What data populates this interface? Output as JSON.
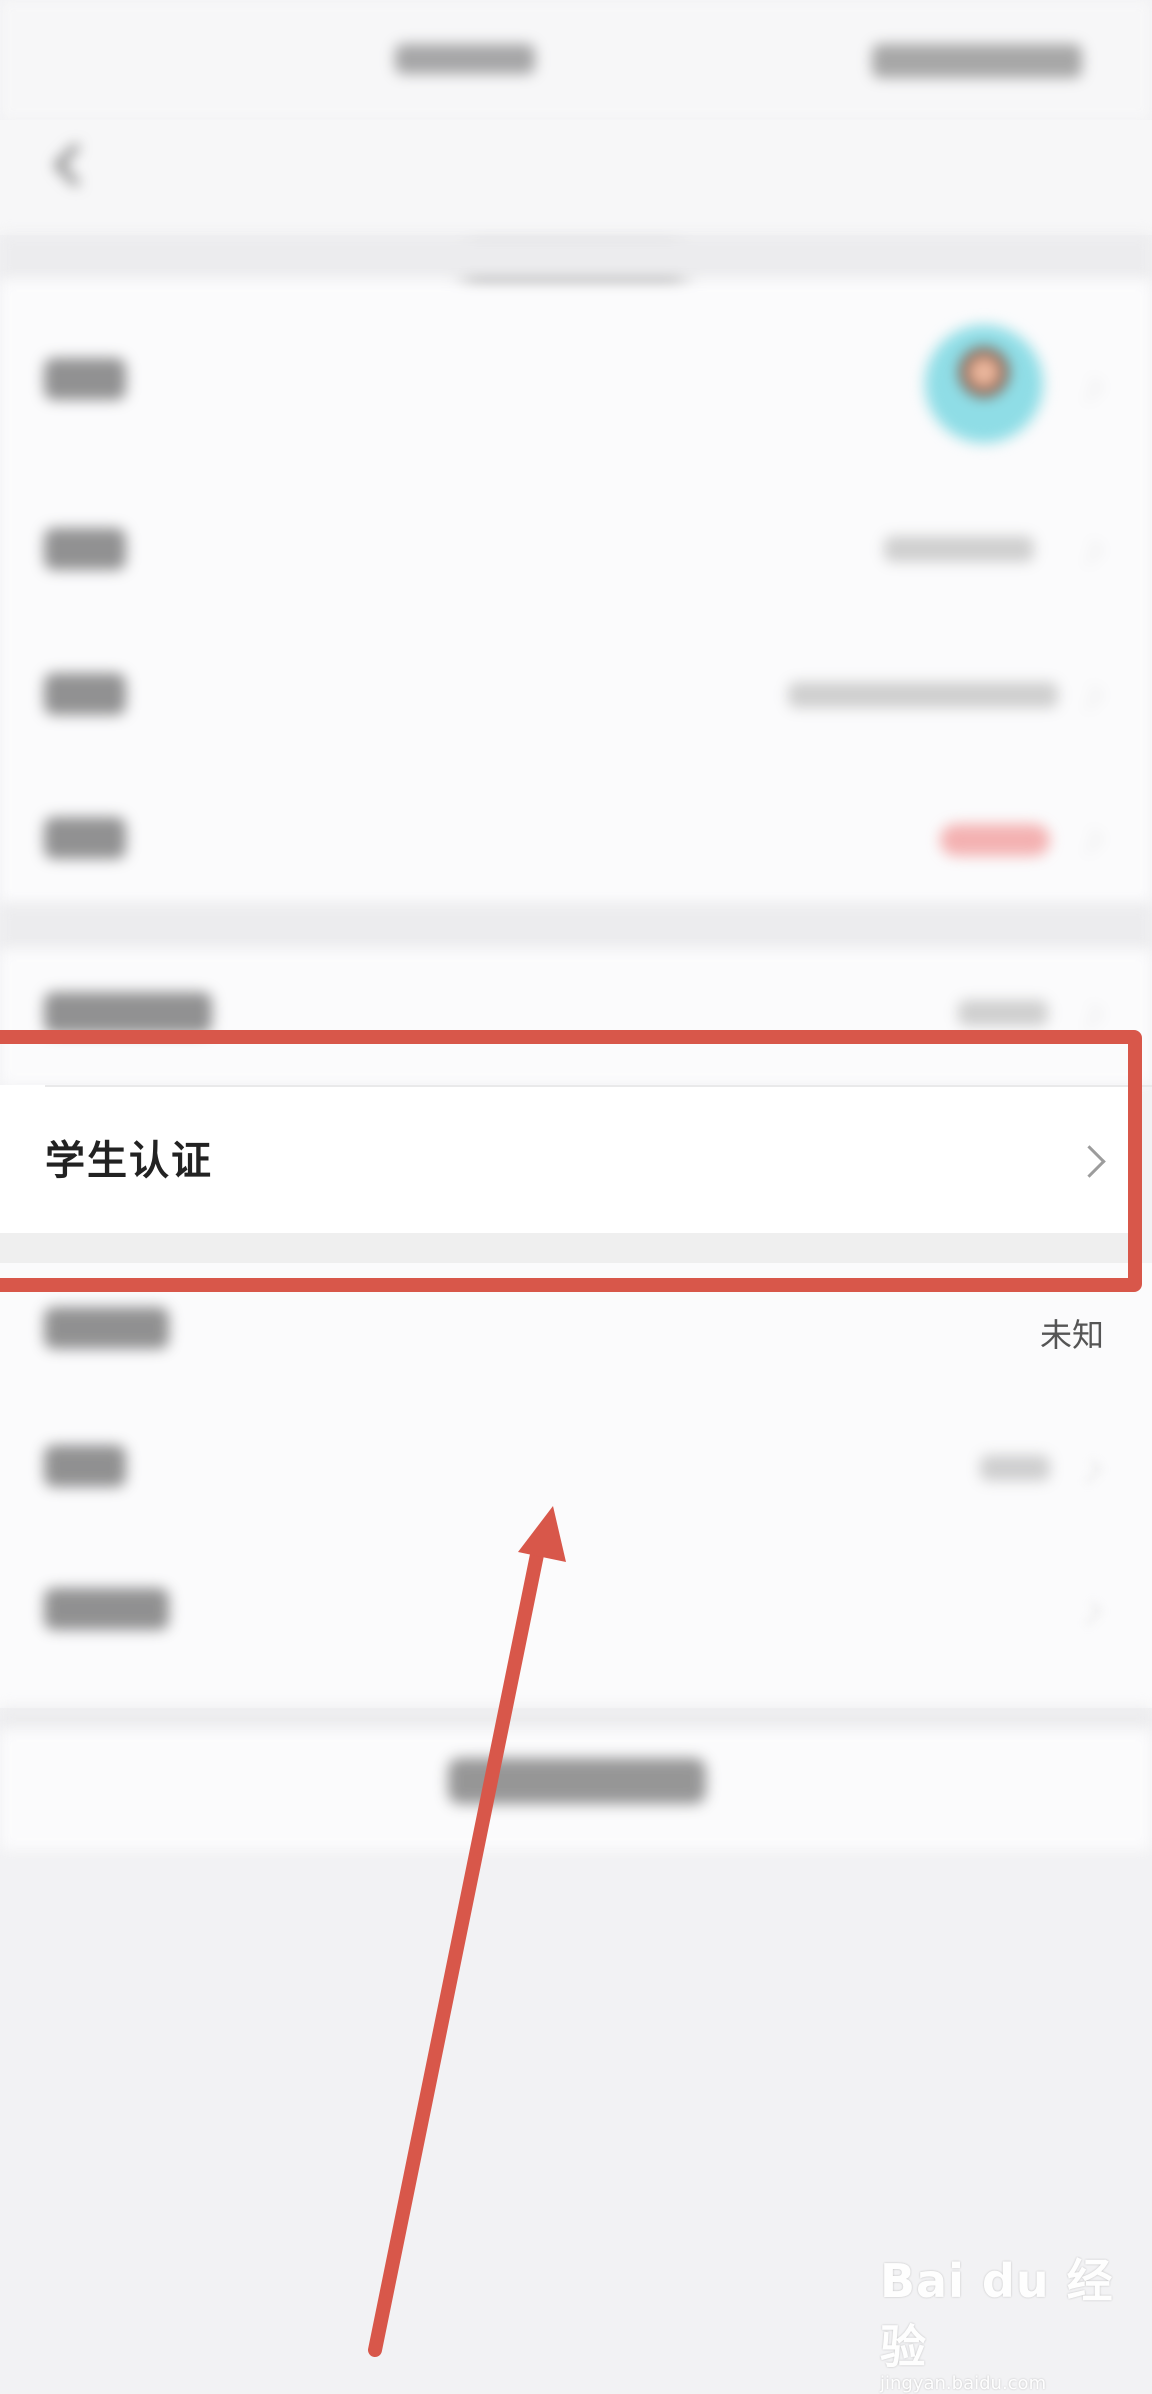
{
  "status_bar": {
    "time": "",
    "indicators": ""
  },
  "nav": {
    "title": "",
    "back_icon": "chevron-left-icon"
  },
  "profile_rows": [
    {
      "label": "",
      "value": "",
      "type": "avatar"
    },
    {
      "label": "",
      "value": ""
    },
    {
      "label": "",
      "value": ""
    },
    {
      "label": "",
      "value": "",
      "badge_color": "#f08a8a"
    }
  ],
  "verify_rows": [
    {
      "label": "",
      "value": ""
    },
    {
      "label": "学生认证",
      "value": ""
    }
  ],
  "info_rows": [
    {
      "label": "",
      "value": "未知"
    },
    {
      "label": "",
      "value": ""
    },
    {
      "label": "",
      "value": ""
    }
  ],
  "footer": {
    "button_label": ""
  },
  "watermark": {
    "main": "Bai du 经验",
    "sub": "jingyan.baidu.com"
  },
  "colors": {
    "highlight": "#d8574a",
    "arrow": "#d8574a",
    "background": "#f2f2f4",
    "card": "#fbfbfc"
  }
}
